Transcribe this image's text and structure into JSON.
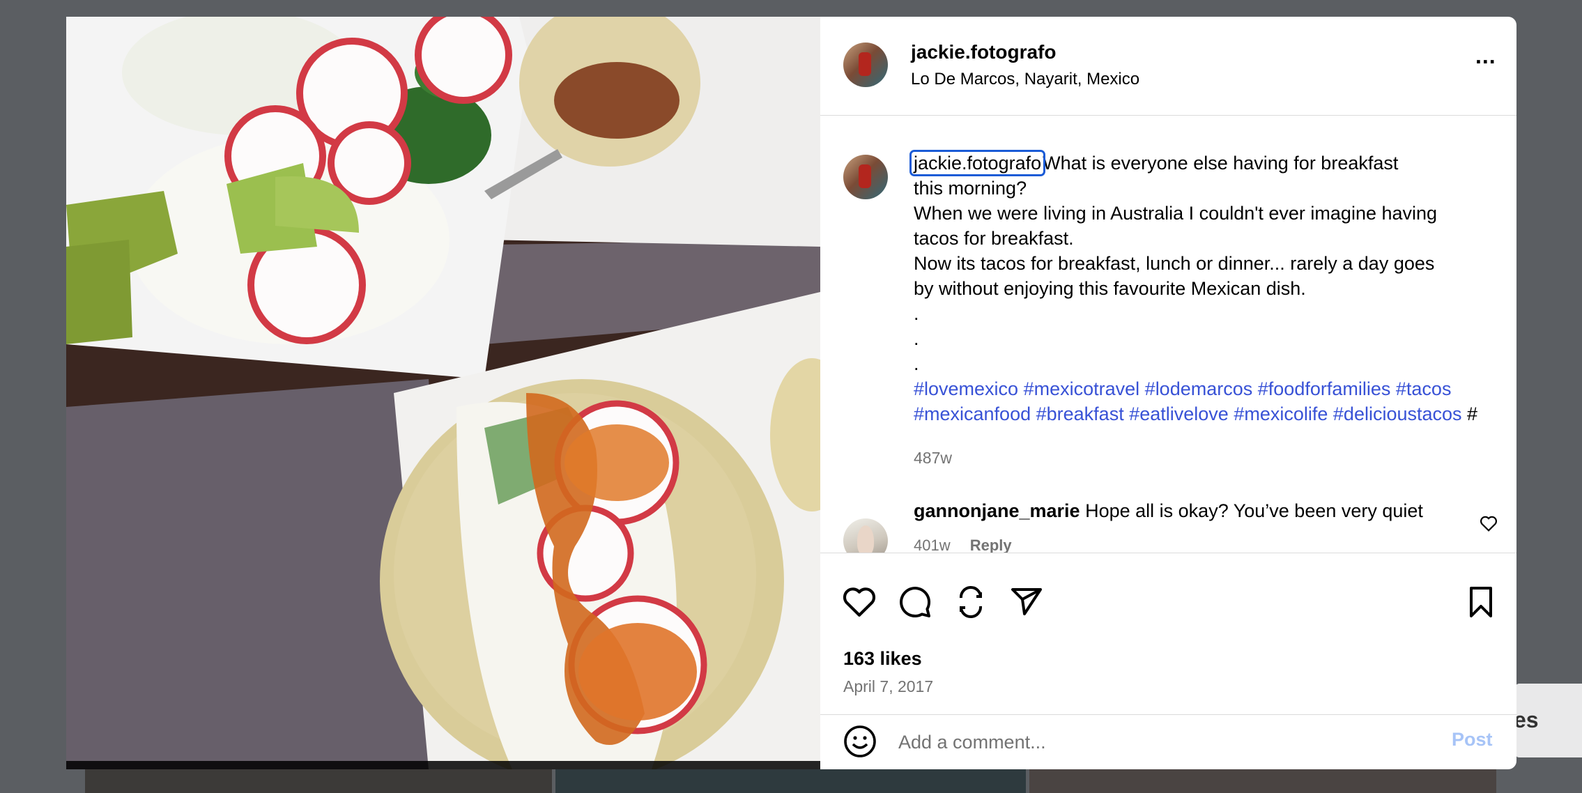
{
  "post": {
    "username": "jackie.fotografo",
    "location": "Lo De Marcos, Nayarit, Mexico",
    "more_label": "...",
    "caption": {
      "username": "jackie.fotografo",
      "line1": "What is everyone else having for breakfast",
      "line2": "this morning?",
      "line3": "When we were living in Australia I couldn't ever imagine having",
      "line4": "tacos for breakfast.",
      "line5": "Now its tacos for breakfast, lunch or dinner... rarely a day goes",
      "line6": "by without enjoying this favourite Mexican dish.",
      "dot1": ".",
      "dot2": ".",
      "dot3": ".",
      "hashtags": [
        "#lovemexico",
        "#mexicotravel",
        "#lodemarcos",
        "#foodforfamilies",
        "#tacos",
        "#mexicanfood",
        "#breakfast",
        "#eatlivelove",
        "#mexicolife",
        "#delicioustacos"
      ],
      "trailing": "#"
    },
    "caption_time": "487w",
    "comment": {
      "username": "gannonjane_marie",
      "text": "Hope all is okay? You’ve been very quiet",
      "time": "401w",
      "reply": "Reply"
    },
    "likes": "163 likes",
    "date": "April 7, 2017",
    "add_comment_placeholder": "Add a comment...",
    "post_label": "Post",
    "icons": [
      "heart-icon",
      "comment-icon",
      "repost-icon",
      "share-icon",
      "bookmark-icon",
      "emoji-icon",
      "more-icon"
    ]
  },
  "background": {
    "partial_text": "es"
  },
  "colors": {
    "hashtag": "#3852d6",
    "muted": "#737373",
    "post_disabled": "#a7c4f7",
    "focus": "#1a5bd6"
  }
}
